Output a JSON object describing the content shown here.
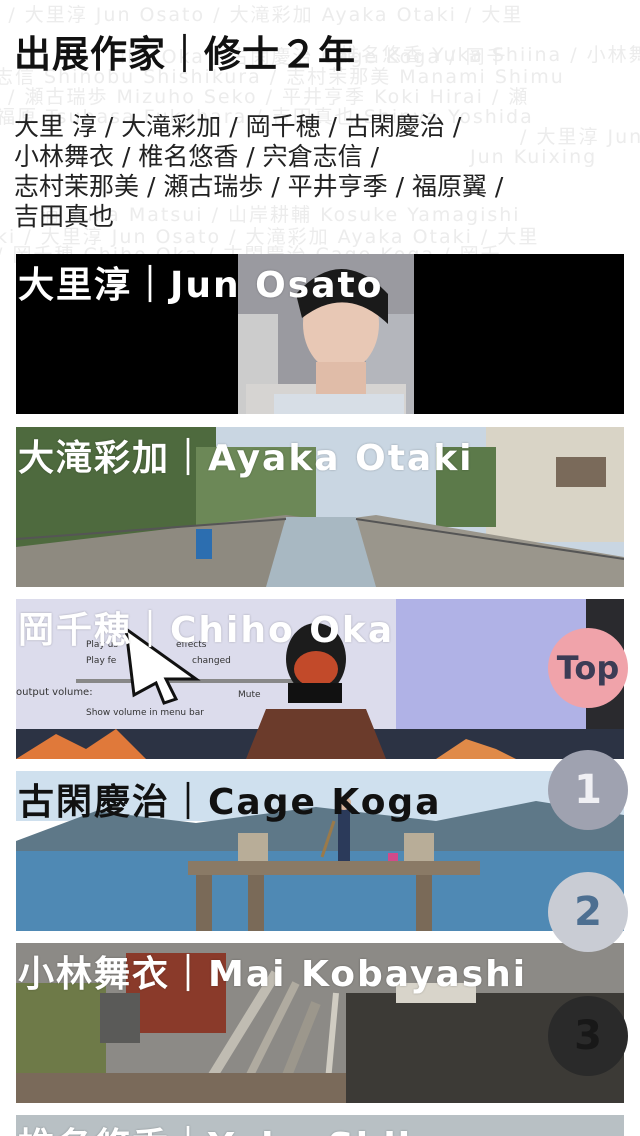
{
  "heading": "出展作家｜修士２年",
  "artists_lines": [
    "大里 淳 / 大滝彩加 / 岡千穂 / 古閑慶治 /",
    "小林舞衣 / 椎名悠香 / 宍倉志信 /",
    "志村茉那美 / 瀬古瑞歩 / 平井亨季 / 福原翼 /",
    "吉田真也"
  ],
  "cards": [
    {
      "label": "大里淳｜Jun Osato"
    },
    {
      "label": "大滝彩加｜Ayaka Otaki"
    },
    {
      "label": "岡千穂｜Chiho Oka"
    },
    {
      "label": "古閑慶治｜Cage Koga"
    },
    {
      "label": "小林舞衣｜Mai Kobayashi"
    },
    {
      "label": "椎名悠香｜Yuka Shiina"
    }
  ],
  "nav": {
    "top_label": "Top",
    "one_label": "1",
    "two_label": "2",
    "three_label": "3"
  },
  "settings_screen": {
    "play_user": "Play us",
    "play_feedback": "Play fe",
    "effects": "effects",
    "changed": "changed",
    "output_volume": "output volume:",
    "mute": "Mute",
    "show_volume": "Show volume in menu bar"
  },
  "background_text": [
    "ki / 大里淳 Jun Osato / 大滝彩加 Ayaka Otaki / 大里",
    "ika Oka / 古閑慶治 Cage Koga / 岡千",
    "椎名悠香 Yuka Shiina / 小林舞衣 Mai Kobayashi / 宍倉",
    "志信 Shinobu Shishikura / 志村茉那美 Manami Shimu",
    "/ 瀬古瑞歩 Mizuho Seko / 平井亨季 Koki Hirai / 瀬",
    "福原 Tsubasa Fukuhara / 吉田真也 Shinya Yoshida",
    "/ 大里淳 Jun Osato / Jajima",
    "Jun Kuixing",
    "浦 Yuka Matsui / 山岸耕輔 Kosuke Yamagishi",
    "ki / 大里淳 Jun Osato / 大滝彩加 Ayaka Otaki / 大里",
    "/ 岡千穂 Chiho Oka / 古閑慶治 Cage Koga / 岡千"
  ],
  "colors": {
    "top_fab": "#f0a3aa",
    "fab_1": "#9fa2b0",
    "fab_2": "#c9ccd4",
    "fab_3": "#2a2a2a"
  }
}
